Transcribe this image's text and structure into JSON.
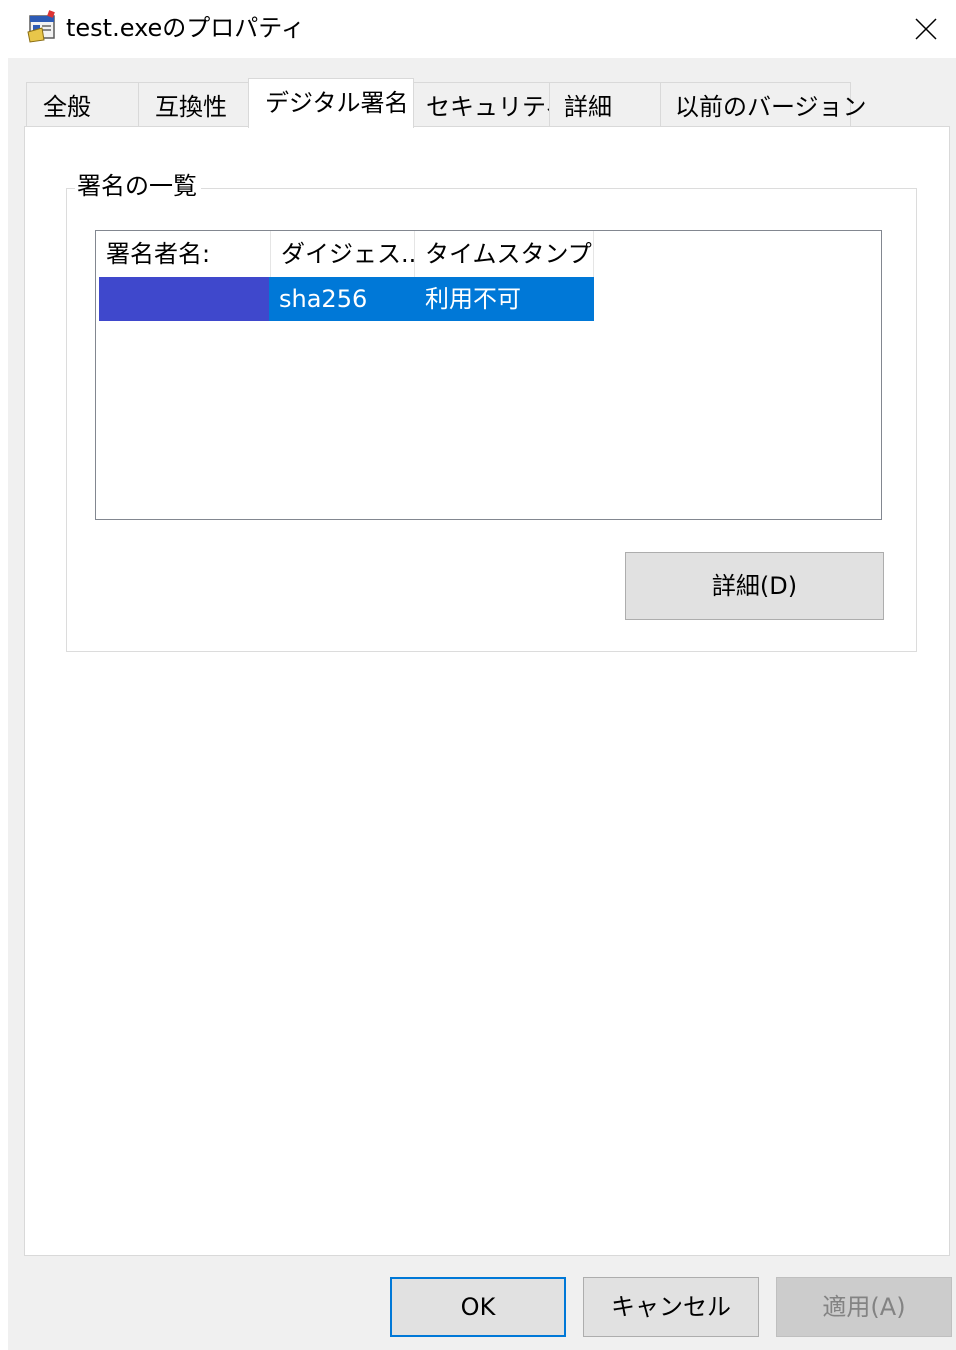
{
  "window": {
    "title": "test.exeのプロパティ"
  },
  "tabs": [
    {
      "label": "全般",
      "active": false
    },
    {
      "label": "互換性",
      "active": false
    },
    {
      "label": "デジタル署名",
      "active": true
    },
    {
      "label": "セキュリティ",
      "active": false
    },
    {
      "label": "詳細",
      "active": false
    },
    {
      "label": "以前のバージョン",
      "active": false
    }
  ],
  "signature_list": {
    "group_label": "署名の一覧",
    "columns": [
      "署名者名:",
      "ダイジェス...",
      "タイムスタンプ"
    ],
    "rows": [
      {
        "signer": "",
        "digest": "sha256",
        "timestamp": "利用不可",
        "selected": true
      }
    ],
    "details_button": "詳細(D)"
  },
  "footer": {
    "ok": "OK",
    "cancel": "キャンセル",
    "apply": "適用(A)"
  },
  "colors": {
    "selection": "#0078d7",
    "redaction": "#3f48cc",
    "default_button_border": "#0078d7"
  }
}
